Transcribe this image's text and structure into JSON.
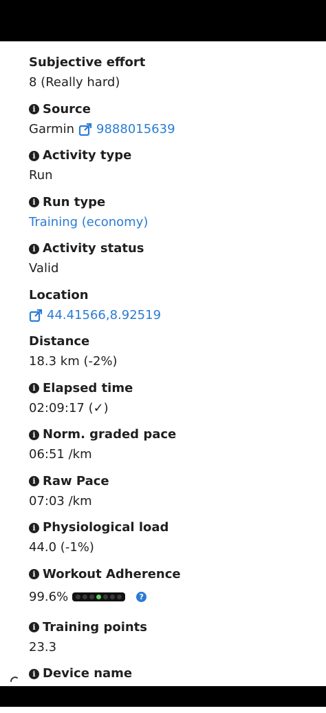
{
  "fields": [
    {
      "label": "Subjective effort",
      "value": "8 (Really hard)"
    },
    {
      "label": "Source",
      "source_prefix": "Garmin",
      "source_link": "9888015639"
    },
    {
      "label": "Activity type",
      "value": "Run"
    },
    {
      "label": "Run type",
      "value": "Training (economy)"
    },
    {
      "label": "Activity status",
      "value": "Valid"
    },
    {
      "label": "Location",
      "value": "44.41566,8.92519"
    },
    {
      "label": "Distance",
      "value": "18.3 km (-2%)"
    },
    {
      "label": "Elapsed time",
      "value": "02:09:17 (✓)"
    },
    {
      "label": "Norm. graded pace",
      "value": "06:51 /km"
    },
    {
      "label": "Raw Pace",
      "value": "07:03 /km"
    },
    {
      "label": "Physiological load",
      "value": "44.0 (-1%)"
    },
    {
      "label": "Workout Adherence",
      "value": "99.6%",
      "adherence_level": 0.996
    },
    {
      "label": "Training points",
      "value": "23.3"
    },
    {
      "label": "Device name"
    }
  ],
  "icons": {
    "info": "info-icon",
    "external_link": "external-link-icon",
    "help": "help-icon"
  },
  "colors": {
    "link": "#2b7bd4",
    "indicator_on": "#5ed35e"
  }
}
